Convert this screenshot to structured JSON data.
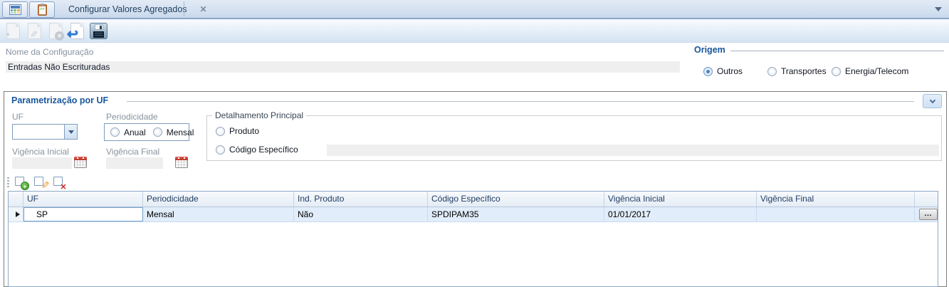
{
  "colors": {
    "accent_blue": "#17569b",
    "tabstrip_bg": "#d2dff0",
    "selected_row_bg": "#e1edfa",
    "disabled_field_bg": "#efefef",
    "calendar_red": "#c24335",
    "add_green": "#3c9a2e",
    "delete_red": "#cc2a2a"
  },
  "icons": {
    "tab1": "grid-palette-icon",
    "tab2": "checklist-clipboard-icon",
    "close_glyph": "✕",
    "overflow": "dropdown-arrow",
    "star_glyph": "✦",
    "pencil_glyph": "✎",
    "cancel_glyph": "✕",
    "undo_glyph": "↩",
    "delete_glyph": "✕",
    "add_glyph": "+"
  },
  "tabs": {
    "active_tab": {
      "label": "Configurar Valores Agregados",
      "close_glyph": "✕"
    }
  },
  "toolbar": {
    "buttons": [
      {
        "name": "new",
        "enabled": false
      },
      {
        "name": "edit",
        "enabled": false
      },
      {
        "name": "cancel",
        "enabled": false
      },
      {
        "name": "undo",
        "enabled": true
      },
      {
        "name": "save",
        "enabled": true
      }
    ]
  },
  "form": {
    "nome_label": "Nome da Configuração",
    "nome_value": "Entradas Não Escrituradas",
    "origem": {
      "title": "Origem",
      "options": [
        {
          "label": "Outros",
          "selected": true
        },
        {
          "label": "Transportes",
          "selected": false
        },
        {
          "label": "Energia/Telecom",
          "selected": false
        }
      ]
    }
  },
  "parametrizacao": {
    "title": "Parametrização por UF",
    "uf_label": "UF",
    "uf_value": "",
    "periodicidade_label": "Periodicidade",
    "periodicidade_options": [
      {
        "label": "Anual",
        "selected": false
      },
      {
        "label": "Mensal",
        "selected": false
      }
    ],
    "vigencia_inicial_label": "Vigência Inicial",
    "vigencia_inicial_value": "",
    "vigencia_final_label": "Vigência Final",
    "vigencia_final_value": "",
    "detalhamento": {
      "title": "Detalhamento Principal",
      "options": [
        {
          "label": "Produto",
          "selected": false
        },
        {
          "label": "Código Específico",
          "selected": false
        }
      ],
      "codigo_value": ""
    }
  },
  "grid": {
    "columns": [
      "UF",
      "Periodicidade",
      "Ind. Produto",
      "Código Específico",
      "Vigência Inicial",
      "Vigência Final"
    ],
    "rows": [
      {
        "uf": "SP",
        "periodicidade": "Mensal",
        "ind_produto": "Não",
        "codigo_especifico": "SPDIPAM35",
        "vigencia_inicial": "01/01/2017",
        "vigencia_final": "",
        "actions": "…"
      }
    ]
  }
}
